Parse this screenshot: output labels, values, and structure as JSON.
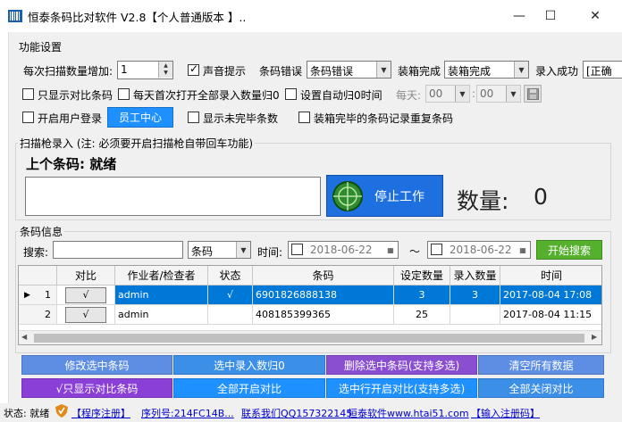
{
  "window": {
    "title": "恒泰条码比对软件 V2.8【个人普通版本 】..",
    "minimize": "—",
    "maximize": "☐",
    "close": "✕"
  },
  "settings": {
    "section_title": "功能设置",
    "scan_increment_label": "每次扫描数量增加:",
    "scan_increment_value": "1",
    "sound_prompt_label": "声音提示",
    "sound_prompt_checked": true,
    "barcode_error_label": "条码错误",
    "barcode_error_value": "条码错误",
    "box_complete_label": "装箱完成",
    "box_complete_value": "装箱完成",
    "entry_success_label": "录入成功",
    "entry_success_value": "[正确",
    "only_show_compare_label": "只显示对比条码",
    "daily_reset_label": "每天首次打开全部录入数量归0",
    "auto_reset_time_label": "设置自动归0时间",
    "daily_label": "每天:",
    "hour_value": "00",
    "minute_value": "00",
    "enable_login_label": "开启用户登录",
    "staff_center_label": "员工中心",
    "show_unfinished_label": "显示未完毕条数",
    "repeat_record_label": "装箱完毕的条码记录重复条码"
  },
  "scanner": {
    "section_title": "扫描枪录入 (注: 必须要开启扫描枪自带回车功能)",
    "last_code_label": "上个条码: 就绪",
    "input_value": "",
    "stop_button_label": "停止工作",
    "count_label": "数量:",
    "count_value": "0"
  },
  "barcode_info": {
    "section_title": "条码信息",
    "search_label": "搜索:",
    "search_value": "",
    "search_field_value": "条码",
    "time_label": "时间:",
    "date_from": "2018-06-22",
    "tilde": "～",
    "date_to": "2018-06-22",
    "start_search_label": "开始搜索"
  },
  "table": {
    "columns": [
      "对比",
      "作业者/检查者",
      "状态",
      "条码",
      "设定数量",
      "录入数量",
      "时间"
    ],
    "rows": [
      {
        "num": "1",
        "compare": "√",
        "operator": "admin",
        "status": "√",
        "barcode": "6901826888138",
        "set_qty": "3",
        "entry_qty": "3",
        "time": "2017-08-04 17:08",
        "selected": true
      },
      {
        "num": "2",
        "compare": "√",
        "operator": "admin",
        "status": "",
        "barcode": "408185399365",
        "set_qty": "25",
        "entry_qty": "",
        "time": "2017-08-04 11:15",
        "selected": false
      }
    ]
  },
  "buttons": {
    "modify_selected": "修改选中条码",
    "reset_selected_qty": "选中录入数归0",
    "delete_selected": "删除选中条码(支持多选)",
    "clear_all": "清空所有数据",
    "only_show_compare": "√只显示对比条码",
    "enable_all_compare": "全部开启对比",
    "enable_selected_compare": "选中行开启对比(支持多选)",
    "disable_all_compare": "全部关闭对比"
  },
  "statusbar": {
    "state": "状态: 就绪",
    "register": "【程序注册】",
    "serial": "序列号:214FC14B...",
    "contact": "联系我们QQ157322145",
    "website": "恒泰软件www.htai51.com",
    "enter_code": "【输入注册码】"
  },
  "colors": {
    "accent_blue": "#1e90ff",
    "selection": "#0078d7",
    "search_green": "#55b02e"
  }
}
